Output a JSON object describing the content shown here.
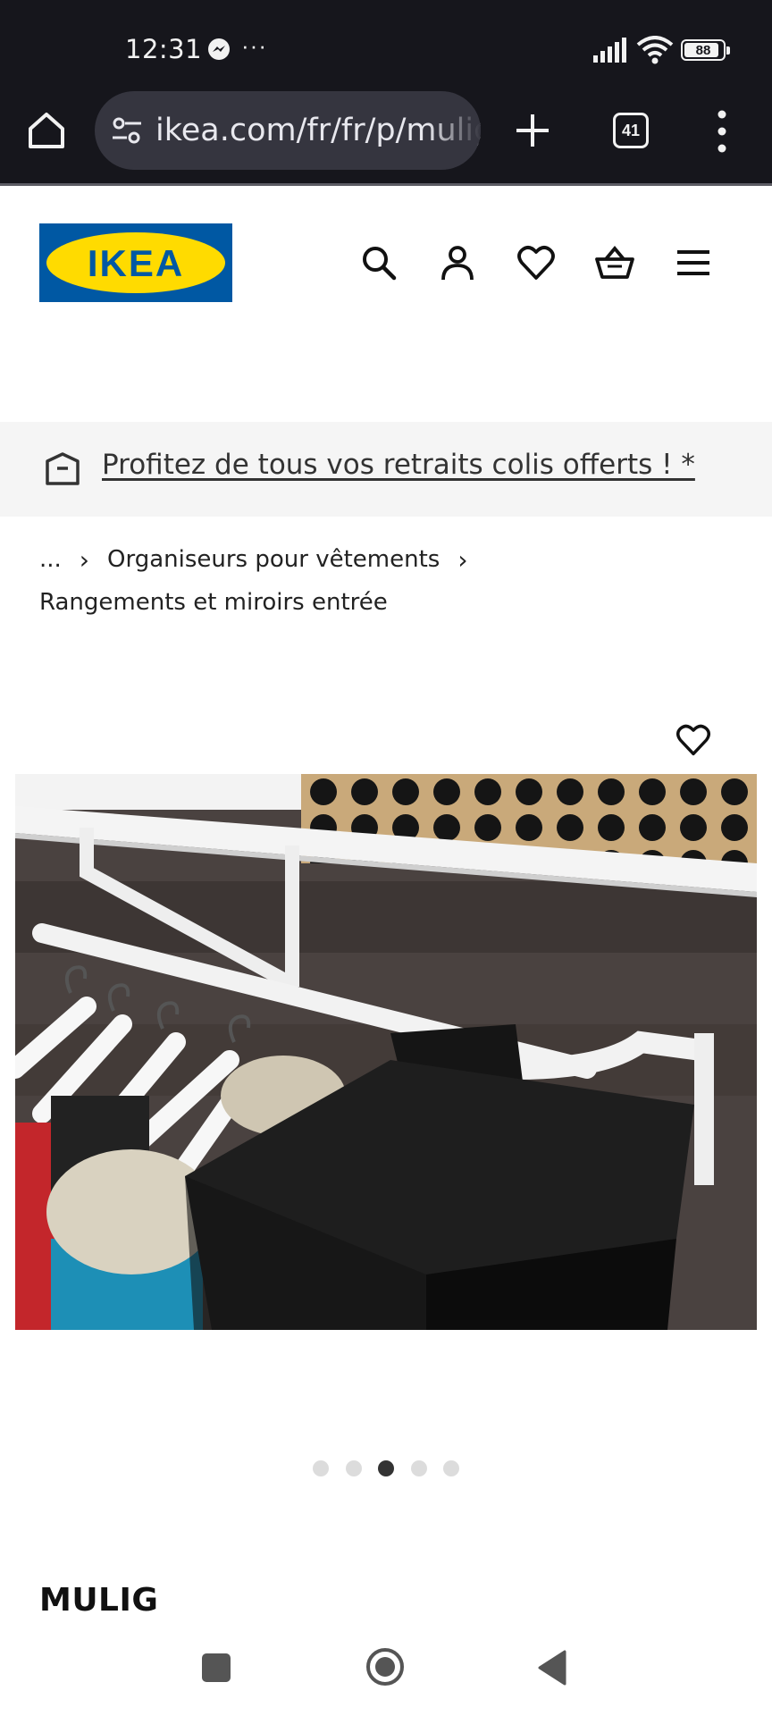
{
  "status_bar": {
    "time": "12:31",
    "overflow_dots": "···",
    "battery": "88",
    "icons": [
      "messenger-icon",
      "signal-icon",
      "wifi-icon",
      "battery-icon"
    ]
  },
  "browser": {
    "url": "ikea.com/fr/fr/p/mulig-",
    "tab_count": "41",
    "icons": [
      "home-icon",
      "site-settings-icon",
      "new-tab-icon",
      "tabs-icon",
      "more-vert-icon"
    ]
  },
  "header": {
    "logo_text": "IKEA",
    "icons": [
      "search-icon",
      "account-icon",
      "favorites-icon",
      "cart-icon",
      "hamburger-menu-icon"
    ]
  },
  "promo": {
    "text": "Profitez de tous vos retraits colis offerts ! *",
    "icon": "store-box-icon"
  },
  "breadcrumb": {
    "ellipsis": "...",
    "separator": "›",
    "item_1": "Organiseurs pour vêtements",
    "current": "Rangements et miroirs entrée"
  },
  "product": {
    "name": "MULIG",
    "image_description_icon": "product-photo",
    "carousel": {
      "total": 5,
      "active_index": 2
    }
  },
  "colors": {
    "ikea_blue": "#0058a3",
    "ikea_yellow": "#ffdb00",
    "status_bar_bg": "#16161c",
    "url_pill_bg": "#35353f",
    "promo_bg": "#f5f5f5"
  }
}
